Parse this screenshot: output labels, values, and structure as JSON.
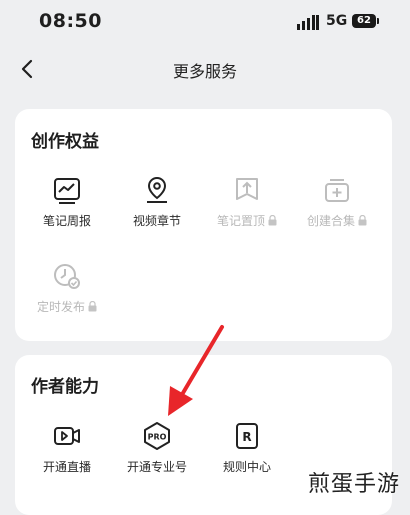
{
  "status_bar": {
    "time": "08:50",
    "network": "5G",
    "battery": "62"
  },
  "nav": {
    "title": "更多服务"
  },
  "sections": {
    "creation": {
      "title": "创作权益",
      "items": [
        {
          "label": "笔记周报",
          "icon": "weekly-report-icon",
          "locked": false
        },
        {
          "label": "视频章节",
          "icon": "video-chapter-icon",
          "locked": false
        },
        {
          "label": "笔记置顶",
          "icon": "pin-note-icon",
          "locked": true
        },
        {
          "label": "创建合集",
          "icon": "create-collection-icon",
          "locked": true
        },
        {
          "label": "定时发布",
          "icon": "scheduled-publish-icon",
          "locked": true
        }
      ]
    },
    "author": {
      "title": "作者能力",
      "items": [
        {
          "label": "开通直播",
          "icon": "live-stream-icon",
          "locked": false
        },
        {
          "label": "开通专业号",
          "icon": "pro-badge-icon",
          "locked": false
        },
        {
          "label": "规则中心",
          "icon": "rules-center-icon",
          "locked": false
        }
      ]
    }
  },
  "watermark": "煎蛋手游",
  "colors": {
    "background": "#eeeff1",
    "card": "#ffffff",
    "text": "#2b2b2b",
    "disabled": "#b8b8b8",
    "arrow": "#e8262a"
  }
}
